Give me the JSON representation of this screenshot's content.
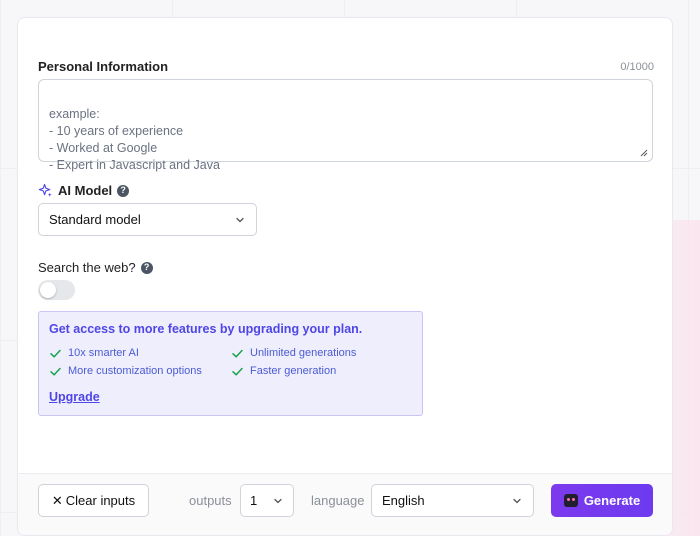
{
  "personal": {
    "label": "Personal Information",
    "counter": "0/1000",
    "placeholder": "example:\n- 10 years of experience\n- Worked at Google\n- Expert in Javascript and Java"
  },
  "model": {
    "label": "AI Model",
    "help": "?",
    "selected": "Standard model",
    "icon": "sparkle-icon"
  },
  "search": {
    "label": "Search the web?",
    "help": "?",
    "enabled": false
  },
  "upgrade": {
    "title": "Get access to more features by upgrading your plan.",
    "features": [
      "10x smarter AI",
      "Unlimited generations",
      "More customization options",
      "Faster generation"
    ],
    "link": "Upgrade",
    "accent": "#4f46e5",
    "check_color": "#16a34a"
  },
  "footer": {
    "clear_label": "Clear inputs",
    "clear_icon": "✕",
    "outputs_label": "outputs",
    "outputs_value": "1",
    "language_label": "language",
    "language_value": "English",
    "generate_label": "Generate",
    "generate_color": "#7c3aed"
  }
}
